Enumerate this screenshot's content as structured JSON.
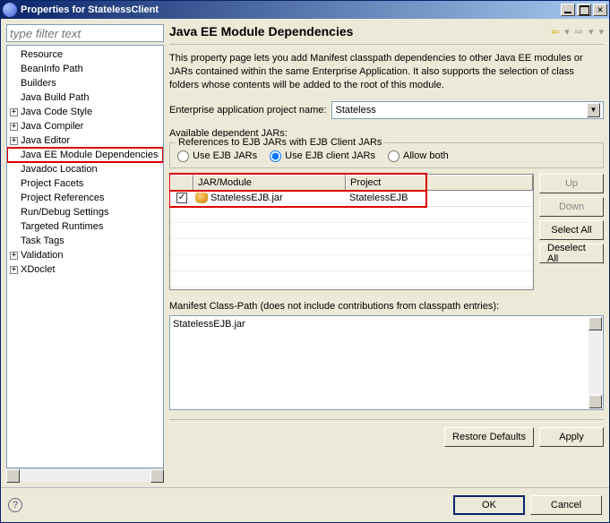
{
  "window": {
    "title": "Properties for StatelessClient"
  },
  "filter": {
    "placeholder": "type filter text"
  },
  "tree": [
    {
      "label": "Resource",
      "exp": false
    },
    {
      "label": "BeanInfo Path",
      "exp": false
    },
    {
      "label": "Builders",
      "exp": false
    },
    {
      "label": "Java Build Path",
      "exp": false
    },
    {
      "label": "Java Code Style",
      "exp": true
    },
    {
      "label": "Java Compiler",
      "exp": true
    },
    {
      "label": "Java Editor",
      "exp": true
    },
    {
      "label": "Java EE Module Dependencies",
      "exp": false,
      "selected": true
    },
    {
      "label": "Javadoc Location",
      "exp": false
    },
    {
      "label": "Project Facets",
      "exp": false
    },
    {
      "label": "Project References",
      "exp": false
    },
    {
      "label": "Run/Debug Settings",
      "exp": false
    },
    {
      "label": "Targeted Runtimes",
      "exp": false
    },
    {
      "label": "Task Tags",
      "exp": false
    },
    {
      "label": "Validation",
      "exp": true
    },
    {
      "label": "XDoclet",
      "exp": true
    }
  ],
  "page": {
    "heading": "Java EE Module Dependencies",
    "description": "This property page lets you add Manifest classpath dependencies to other Java EE modules or JARs contained within the same Enterprise Application. It also supports the selection of class folders whose contents will be added to the root of this module.",
    "project_label": "Enterprise application project name:",
    "project_value": "Stateless",
    "available_label": "Available dependent JARs:",
    "group_legend": "References to EJB JARs with EJB Client JARs",
    "radio_ejb": "Use EJB JARs",
    "radio_client": "Use EJB client JARs",
    "radio_both": "Allow both",
    "col_module": "JAR/Module",
    "col_project": "Project",
    "rows": [
      {
        "checked": true,
        "module": "StatelessEJB.jar",
        "project": "StatelessEJB"
      }
    ],
    "btn_up": "Up",
    "btn_down": "Down",
    "btn_selectall": "Select All",
    "btn_deselectall": "Deselect All",
    "cp_label": "Manifest Class-Path (does not include contributions from classpath entries):",
    "cp_value": "StatelessEJB.jar",
    "btn_restore": "Restore Defaults",
    "btn_apply": "Apply",
    "btn_ok": "OK",
    "btn_cancel": "Cancel"
  }
}
